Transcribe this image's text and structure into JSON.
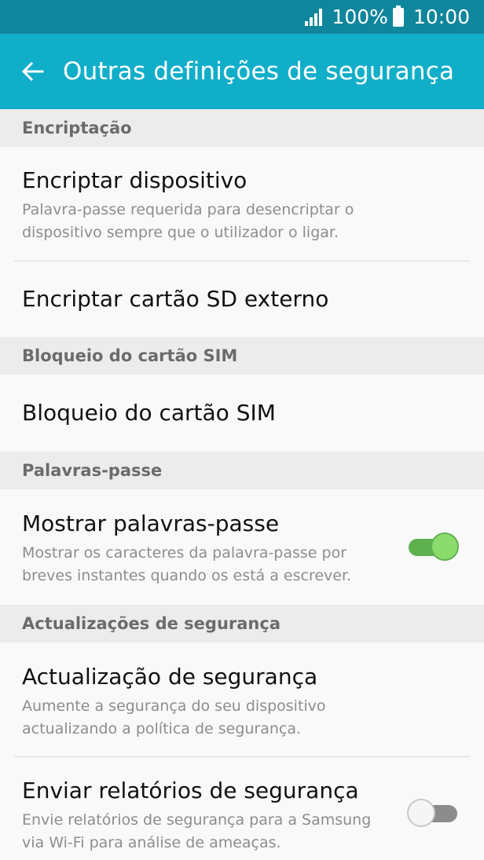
{
  "status_bar": {
    "battery_percent": "100%",
    "time": "10:00",
    "icons": [
      "signal-icon",
      "battery-icon"
    ]
  },
  "app_bar": {
    "back_icon": "back-arrow-icon",
    "title": "Outras definições de segurança"
  },
  "sections": {
    "encryption": {
      "header": "Encriptação",
      "encrypt_device": {
        "title": "Encriptar dispositivo",
        "summary": "Palavra-passe requerida para desencriptar o dispositivo sempre que o utilizador o ligar."
      },
      "encrypt_sd": {
        "title": "Encriptar cartão SD externo"
      }
    },
    "sim_lock": {
      "header": "Bloqueio do cartão SIM",
      "sim_lock_item": {
        "title": "Bloqueio do cartão SIM"
      }
    },
    "passwords": {
      "header": "Palavras-passe",
      "show_passwords": {
        "title": "Mostrar palavras-passe",
        "summary": "Mostrar os caracteres da palavra-passe por breves instantes quando os está a escrever.",
        "enabled": true
      }
    },
    "security_updates": {
      "header": "Actualizações de segurança",
      "security_update": {
        "title": "Actualização de segurança",
        "summary": "Aumente a segurança do seu dispositivo actualizando a política de segurança."
      },
      "send_reports": {
        "title": "Enviar relatórios de segurança",
        "summary": "Envie relatórios de segurança para a Samsung via Wi-Fi para análise de ameaças.",
        "enabled": false
      }
    }
  },
  "colors": {
    "status_bar": "#0f869c",
    "app_bar": "#11aec9",
    "toggle_on": "#5fb04f",
    "toggle_off": "#8c8c8c",
    "background": "#f9f9f9",
    "section_header_bg": "#ececec"
  }
}
